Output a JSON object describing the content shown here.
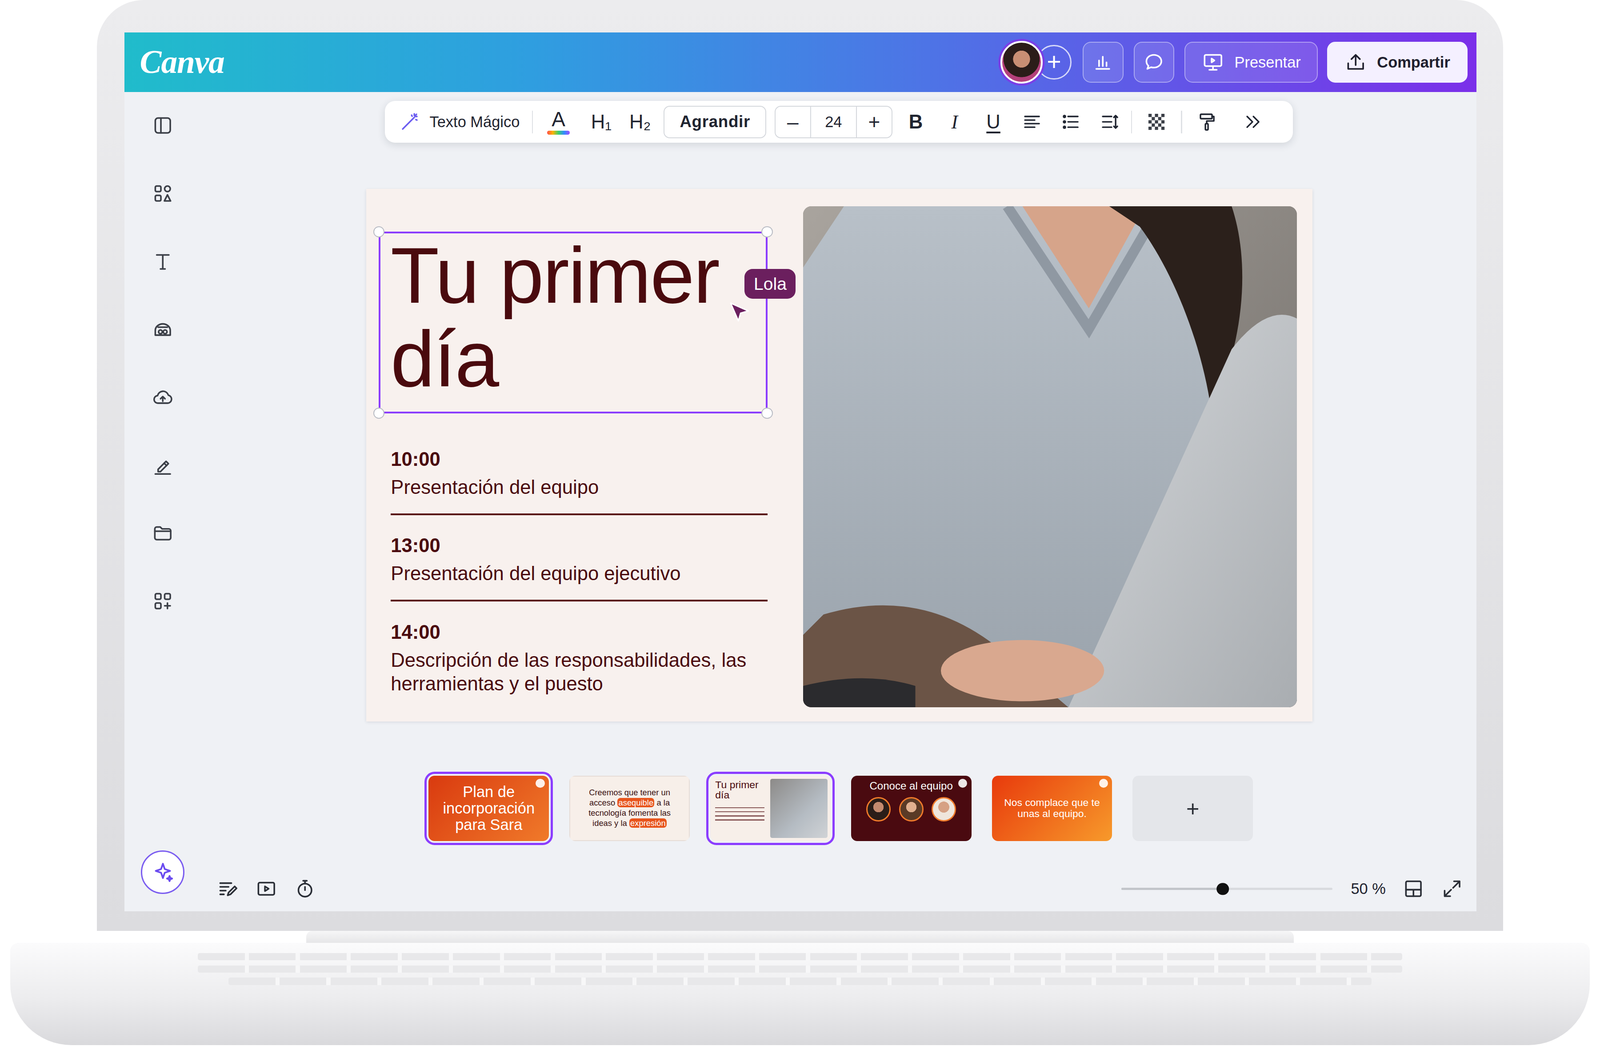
{
  "topbar": {
    "logo": "Canva",
    "invite": "+",
    "present": "Presentar",
    "share": "Compartir"
  },
  "toolbar": {
    "magic_text": "Texto Mágico",
    "text_color": "A",
    "h1": "H₁",
    "h2": "H₂",
    "font": "Agrandir",
    "decrease": "–",
    "font_size": "24",
    "increase": "+",
    "bold": "B",
    "italic": "I",
    "underline": "U"
  },
  "slide": {
    "title": "Tu primer día",
    "title_selected": true,
    "collaborator": "Lola",
    "agenda": [
      {
        "time": "10:00",
        "desc": "Presentación del equipo"
      },
      {
        "time": "13:00",
        "desc": "Presentación del equipo ejecutivo"
      },
      {
        "time": "14:00",
        "desc": "Descripción de las responsabilidades, las herramientas y el puesto"
      }
    ]
  },
  "thumbnails": [
    {
      "kind": "cover",
      "title": "Plan de incorporación para Sara",
      "selected": true
    },
    {
      "kind": "quote",
      "selected": false,
      "segments": [
        {
          "text": "Creemos que tener un acceso ",
          "highlight": false
        },
        {
          "text": "asequible",
          "highlight": true
        },
        {
          "text": " a la tecnología fomenta las ideas y la ",
          "highlight": false
        },
        {
          "text": "expresión",
          "highlight": true
        }
      ]
    },
    {
      "kind": "agenda",
      "title": "Tu primer día",
      "selected": true
    },
    {
      "kind": "team",
      "title": "Conoce al equipo",
      "selected": false
    },
    {
      "kind": "closing",
      "title": "Nos complace que te unas al equipo.",
      "selected": false
    },
    {
      "kind": "add",
      "label": "+",
      "selected": false
    }
  ],
  "zoom": {
    "level": 0.48,
    "reading": "50 %"
  }
}
